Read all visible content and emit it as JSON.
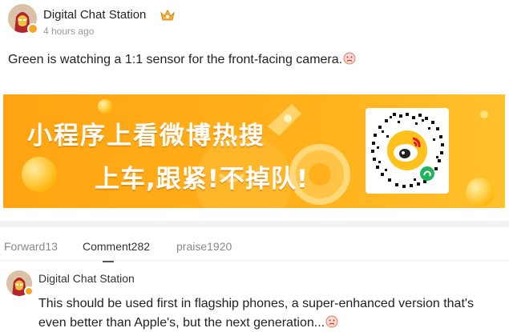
{
  "post": {
    "author": "Digital Chat Station",
    "time": "4 hours ago",
    "text": "Green is watching a 1:1 sensor for the front-facing camera.",
    "verified_icon": "verified-badge-icon",
    "vip_icon": "vip-crown-icon",
    "emoji_icon": "sad-face-emoji-icon"
  },
  "banner": {
    "line1": "小程序上看微博热搜",
    "line2": "上车,跟紧!不掉队!",
    "accent_color": "#ffb11b",
    "qr_icon": "weibo-mini-program-qr-icon"
  },
  "tabs": {
    "forward": "Forward13",
    "comment": "Comment282",
    "praise": "praise1920"
  },
  "comment": {
    "author": "Digital Chat Station",
    "text": "This should be used first in flagship phones, a super-enhanced version that's even better than Apple's, but the next generation..."
  }
}
